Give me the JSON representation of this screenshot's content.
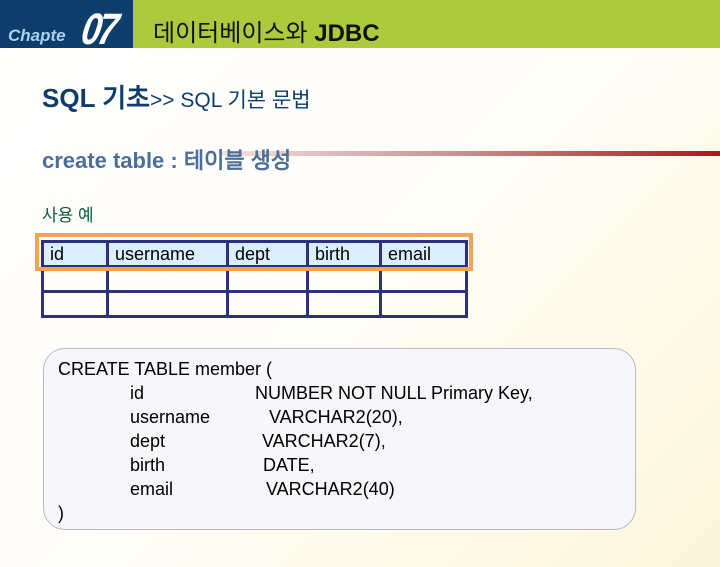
{
  "header": {
    "chapter_word": "Chapte",
    "chapter_number": "07",
    "title_korean": "데이터베이스와 ",
    "title_bold": "JDBC",
    "colors": {
      "left_bg": "#0e3d6b",
      "right_bg": "#acca3c"
    }
  },
  "section": {
    "main": "SQL 기초",
    "sub": ">> SQL 기본 문법"
  },
  "subtitle": "create table : 테이블 생성",
  "example_label": "사용 예",
  "schema_table": {
    "headers": [
      "id",
      "username",
      "dept",
      "birth",
      "email"
    ],
    "rows": [
      [
        "",
        "",
        "",
        "",
        ""
      ],
      [
        "",
        "",
        "",
        "",
        ""
      ]
    ]
  },
  "code": {
    "open": "CREATE TABLE member (",
    "columns": [
      {
        "name": "id",
        "type": "NUMBER NOT NULL Primary Key,"
      },
      {
        "name": "username",
        "type": "VARCHAR2(20),"
      },
      {
        "name": "dept",
        "type": "VARCHAR2(7),"
      },
      {
        "name": "birth",
        "type": "DATE,"
      },
      {
        "name": "email",
        "type": "VARCHAR2(40)"
      }
    ],
    "close": ")"
  }
}
